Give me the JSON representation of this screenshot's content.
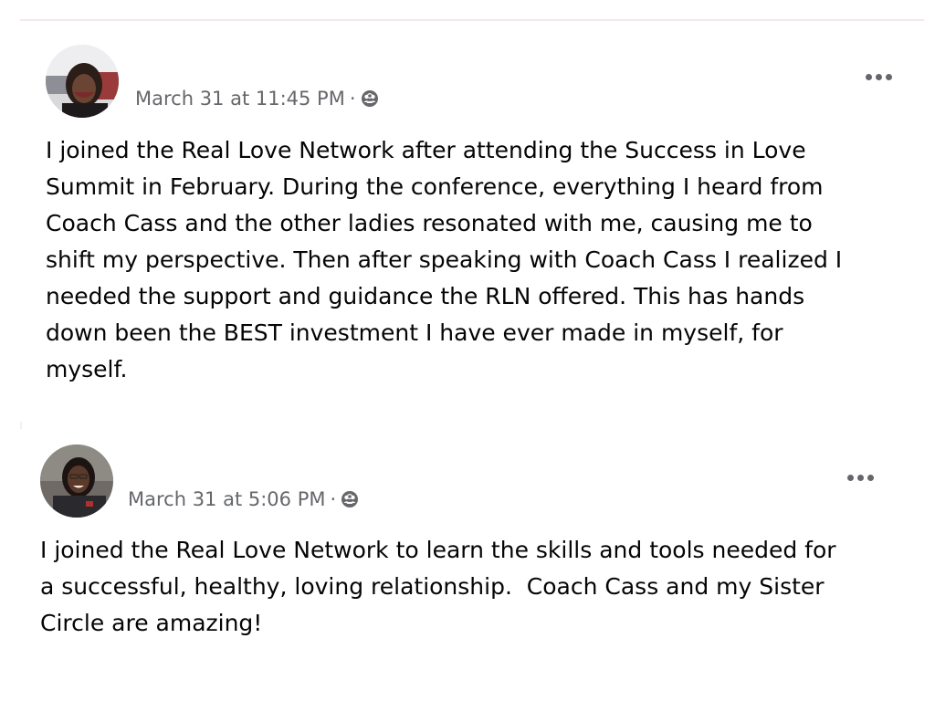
{
  "posts": [
    {
      "timestamp": "March 31 at 11:45 PM",
      "separator": "·",
      "audience_icon": "group-icon",
      "more_icon": "more-options-icon",
      "text": "I joined the Real Love Network after attending the Success in Love\nSummit in February. During the conference, everything I heard from\nCoach Cass and the other ladies resonated with me, causing me to\nshift my perspective. Then after speaking with Coach Cass I realized I\nneeded the support and guidance the RLN offered. This has hands\ndown been the BEST investment I have ever made in myself, for\nmyself."
    },
    {
      "timestamp": "March 31 at 5:06 PM",
      "separator": "·",
      "audience_icon": "group-icon",
      "more_icon": "more-options-icon",
      "text": "I joined the Real Love Network to learn the skills and tools needed for\na successful, healthy, loving relationship.  Coach Cass and my Sister\nCircle are amazing!"
    }
  ],
  "colors": {
    "secondary_text": "#65676b",
    "primary_text": "#050505",
    "divider": "#f2e7ee"
  }
}
